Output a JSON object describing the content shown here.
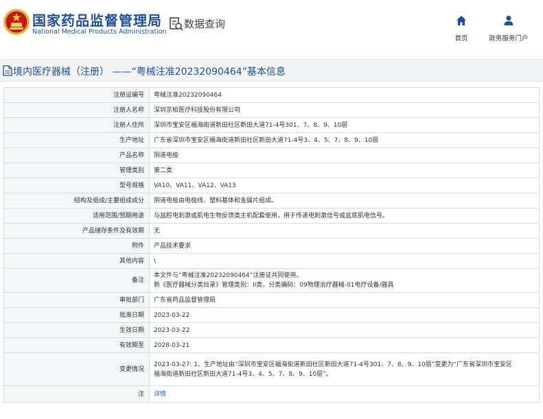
{
  "header": {
    "brand_cn": "国家药品监督管理局",
    "brand_en": "National Medical Products Administration",
    "query_label": "数据查询",
    "nav": {
      "home": "首页",
      "portal": "政务服务门户"
    },
    "brand_color": "#1f4f9c",
    "logo_color": "#c8161d"
  },
  "title": "境内医疗器械（注册） ——“粤械注准20232090464”基本信息",
  "rows": [
    {
      "label": "注册证编号",
      "value": "粤械注准20232090464"
    },
    {
      "label": "注册人名称",
      "value": "深圳京柏医疗科技股份有限公司"
    },
    {
      "label": "注册人住所",
      "value": "深圳市宝安区福海街道新田社区新田大道71-4号301、7、8、9、10层"
    },
    {
      "label": "生产地址",
      "value": "广东省深圳市宝安区福海街道新田社区新田大道71-4号3、4、5、7、8、9、10层"
    },
    {
      "label": "产品名称",
      "value": "阴道电极"
    },
    {
      "label": "管理类别",
      "value": "第二类"
    },
    {
      "label": "型号规格",
      "value": "VA10、VA11、VA12、VA13"
    },
    {
      "label": "结构及组成/主要组成成分",
      "value": "阴道电极由电极线、塑料基体和金属片组成。"
    },
    {
      "label": "适用范围/预期用途",
      "value": "与盆腔电刺激或肌电生物反馈类主机配套使用，用于传递电刺激信号或盆底肌电信号。"
    },
    {
      "label": "产品储存条件及有效期",
      "value": "无"
    },
    {
      "label": "附件",
      "value": "产品技术要求"
    },
    {
      "label": "其他内容",
      "value": "\\"
    },
    {
      "label": "备注",
      "lines": [
        "本文件与“粤械注准20232090464”注册证共同使用。",
        "新《医疗器械分类目录》管理类别：II类，分类编码：09物理治疗器械-01电疗设备/器具"
      ]
    },
    {
      "label": "审批部门",
      "value": "广东省药品监督管理局"
    },
    {
      "label": "批准日期",
      "value": "2023-03-22"
    },
    {
      "label": "生效日期",
      "value": "2023-03-22"
    },
    {
      "label": "有效期至",
      "value": "2028-03-21"
    },
    {
      "label": "变更情况",
      "lines": [
        "2023-03-27: 1、生产地址由“深圳市宝安区福海街道新田社区新田大道71-4号301、7、8、9、10层”变更为“广东省深圳市宝安区",
        "福海街道新田社区新田大道71-4号3、4、5、7、8、9、10层”。"
      ]
    },
    {
      "label": "注",
      "value": "详情",
      "link": true
    }
  ]
}
